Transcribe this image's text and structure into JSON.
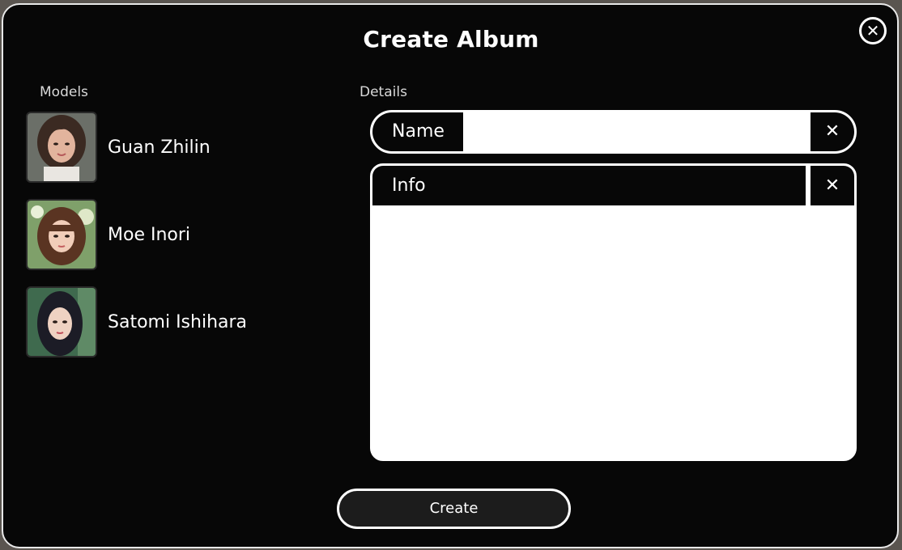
{
  "dialog": {
    "title": "Create Album",
    "close_icon": "close-circle-icon"
  },
  "models": {
    "label": "Models",
    "items": [
      {
        "name": "Guan Zhilin"
      },
      {
        "name": "Moe Inori"
      },
      {
        "name": "Satomi Ishihara"
      }
    ]
  },
  "details": {
    "label": "Details",
    "name_field": {
      "label": "Name",
      "value": "",
      "clear_icon": "close-icon"
    },
    "info_field": {
      "label": "Info",
      "value": "",
      "clear_icon": "close-icon"
    }
  },
  "actions": {
    "create_label": "Create"
  },
  "colors": {
    "background": "#070707",
    "border": "#ffffff",
    "text": "#ffffff",
    "button_fill": "#1c1c1c"
  }
}
